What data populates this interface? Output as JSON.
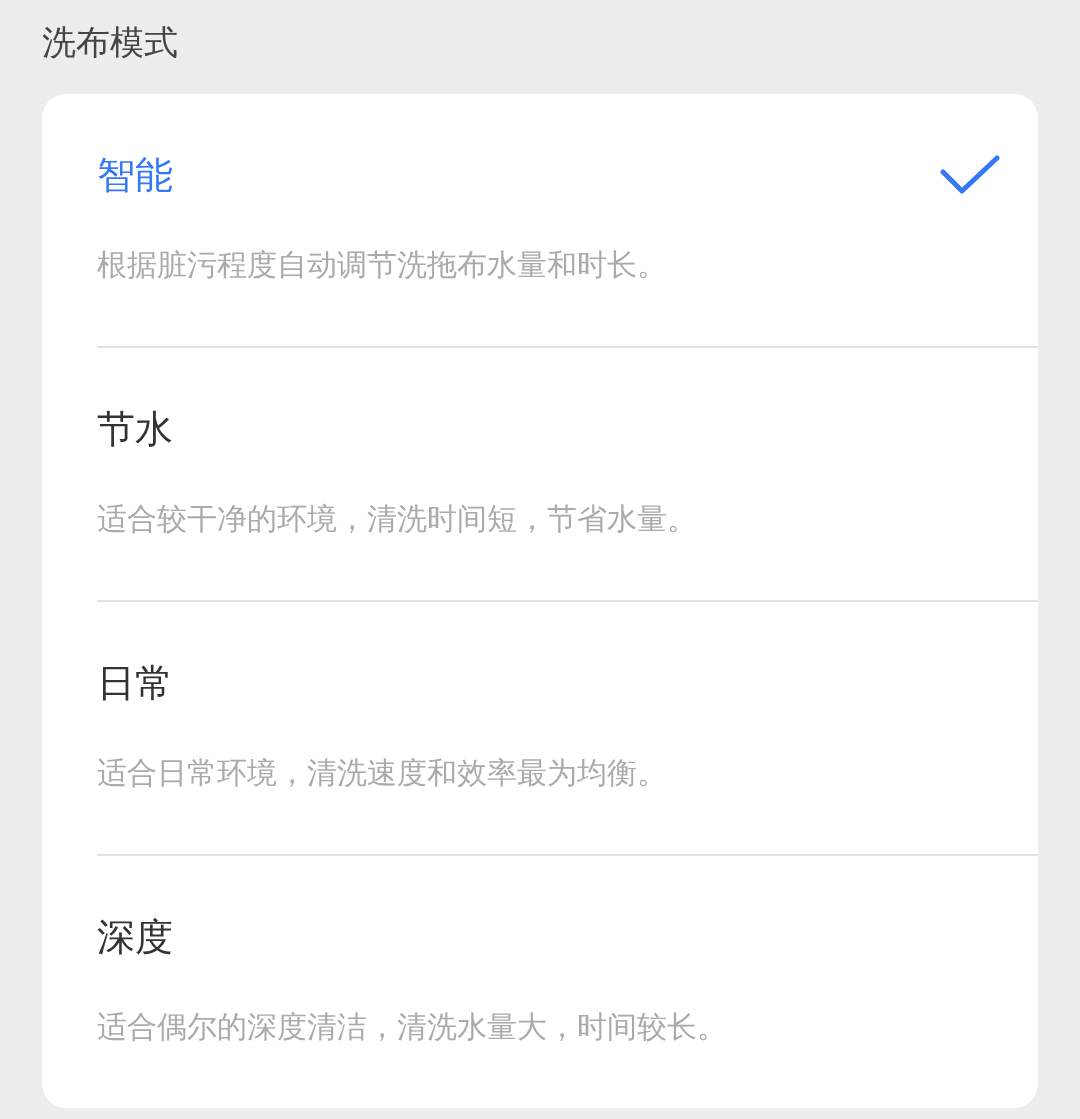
{
  "section_title": "洗布模式",
  "modes": [
    {
      "name": "智能",
      "description": "根据脏污程度自动调节洗拖布水量和时长。",
      "selected": true
    },
    {
      "name": "节水",
      "description": "适合较干净的环境，清洗时间短，节省水量。",
      "selected": false
    },
    {
      "name": "日常",
      "description": "适合日常环境，清洗速度和效率最为均衡。",
      "selected": false
    },
    {
      "name": "深度",
      "description": "适合偶尔的深度清洁，清洗水量大，时间较长。",
      "selected": false
    }
  ]
}
